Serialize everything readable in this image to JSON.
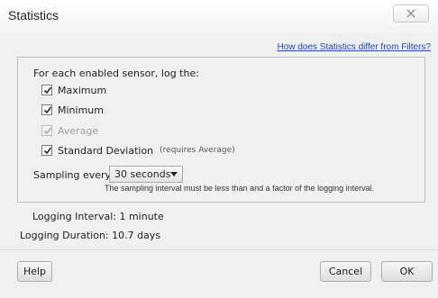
{
  "window": {
    "title": "Statistics",
    "close_icon": "close-icon"
  },
  "help_link": "How does Statistics differ from Filters?",
  "panel": {
    "intro": "For each enabled sensor, log the:",
    "options": [
      {
        "label": "Maximum",
        "checked": true,
        "disabled": false,
        "note": ""
      },
      {
        "label": "Minimum",
        "checked": true,
        "disabled": false,
        "note": ""
      },
      {
        "label": "Average",
        "checked": true,
        "disabled": true,
        "note": ""
      },
      {
        "label": "Standard Deviation",
        "checked": true,
        "disabled": false,
        "note": "(requires Average)"
      }
    ],
    "sampling_label": "Sampling every:",
    "sampling_value": "30 seconds",
    "hint": "The sampling interval must be less than and a factor of the logging interval."
  },
  "info": {
    "logging_interval": "Logging Interval: 1 minute",
    "logging_duration": "Logging Duration: 10.7 days"
  },
  "buttons": {
    "help": "Help",
    "cancel": "Cancel",
    "ok": "OK"
  }
}
